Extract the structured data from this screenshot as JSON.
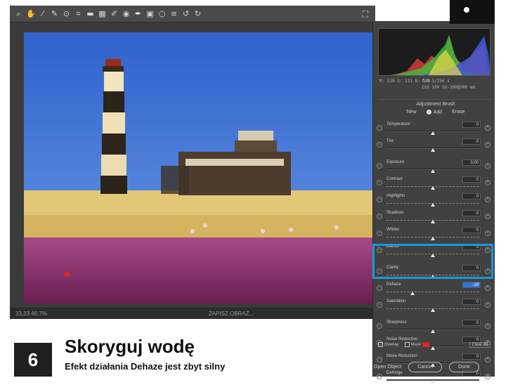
{
  "toolbar": {
    "tools": [
      "zoom-tool",
      "hand-tool",
      "white-balance-tool",
      "color-sampler-tool",
      "targeted-adjustment-tool",
      "crop-tool",
      "straighten-tool",
      "transform-tool",
      "spot-removal-tool",
      "red-eye-tool",
      "adjustment-brush-tool",
      "graduated-filter-tool",
      "radial-filter-tool",
      "preferences-tool",
      "rotate-left-tool",
      "rotate-right-tool"
    ],
    "right_icon": "fullscreen-icon"
  },
  "status": {
    "zoom": "33,33  46,7%",
    "info": "ZAPISZ OBRAZ..."
  },
  "histogram": {
    "rgb_label": "R: 139  G: 111  B: 119",
    "exif_1": "f/8   1/250 s",
    "exif_2": "ISO 100   18-300@300 mm"
  },
  "adjustment": {
    "title": "Adjustment Brush",
    "modes": [
      "New",
      "Add",
      "Erase"
    ]
  },
  "sliders": [
    {
      "label": "Temperature",
      "value": "0"
    },
    {
      "label": "Tint",
      "value": "0"
    },
    {
      "label": "Exposure",
      "value": "0,00"
    },
    {
      "label": "Contrast",
      "value": "0"
    },
    {
      "label": "Highlights",
      "value": "0"
    },
    {
      "label": "Shadows",
      "value": "0"
    },
    {
      "label": "Whites",
      "value": "0"
    },
    {
      "label": "Blacks",
      "value": "0"
    },
    {
      "label": "Clarity",
      "value": "0"
    },
    {
      "label": "Dehaze",
      "value": "-20"
    },
    {
      "label": "Saturation",
      "value": "0"
    },
    {
      "label": "Sharpness",
      "value": "0"
    },
    {
      "label": "Noise Reduction",
      "value": "0"
    },
    {
      "label": "Moire Reduction",
      "value": "0"
    },
    {
      "label": "Defringe",
      "value": "0"
    }
  ],
  "slider_positions": [
    0.5,
    0.5,
    0.5,
    0.5,
    0.5,
    0.5,
    0.5,
    0.5,
    0.5,
    0.28,
    0.5,
    0.5,
    0.5,
    0.5,
    0.5
  ],
  "panel_bottom": {
    "overlay": "Overlay",
    "mask": "Mask",
    "clear_all": "Clear All"
  },
  "footer": {
    "open_object": "Open Object",
    "cancel": "Cancel",
    "done": "Done"
  },
  "caption": {
    "step": "6",
    "title": "Skoryguj wodę",
    "subtitle": "Efekt działania Dehaze jest zbyt silny"
  },
  "colors": {
    "sky": "#3b6fd4",
    "water": "#8a2c6a",
    "highlight": "#1a9ad6",
    "mask_swatch": "#d32a2a"
  }
}
